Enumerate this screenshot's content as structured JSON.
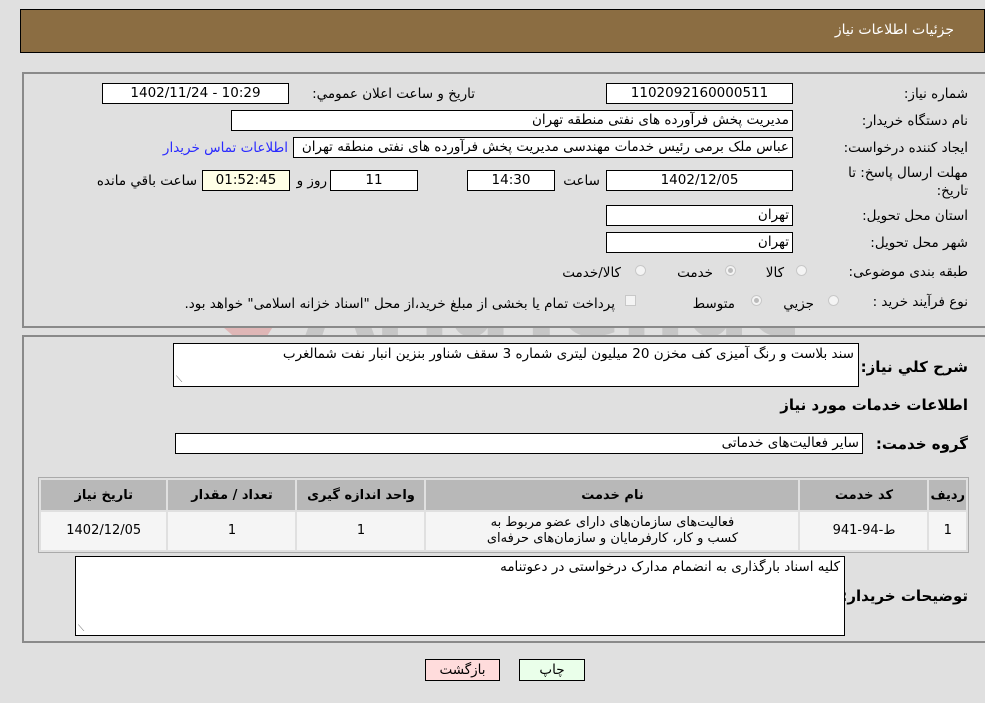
{
  "header": {
    "title": "جزئیات اطلاعات نیاز"
  },
  "form": {
    "need_number_label": "شماره نیاز:",
    "need_number": "1102092160000511",
    "announce_label": "تاریخ و ساعت اعلان عمومي:",
    "announce_value": "1402/11/24 - 10:29",
    "buyer_org_label": "نام دستگاه خریدار:",
    "buyer_org": "مدیریت پخش فرآورده های نفتی منطقه تهران",
    "creator_label": "ایجاد کننده درخواست:",
    "creator": "عباس ملک برمی رئیس خدمات مهندسی مدیریت پخش فرآورده های نفتی منطقه تهران",
    "contact_link": "اطلاعات تماس خریدار",
    "deadline_label": "مهلت ارسال پاسخ: تا تاریخ:",
    "deadline_date": "1402/12/05",
    "time_label": "ساعت",
    "deadline_time": "14:30",
    "days_remaining": "11",
    "days_label": "روز و",
    "time_remaining": "01:52:45",
    "remaining_label": "ساعت باقي مانده",
    "province_label": "استان محل تحویل:",
    "province": "تهران",
    "city_label": "شهر محل تحویل:",
    "city": "تهران",
    "category_label": "طبقه بندی موضوعی:",
    "category_options": [
      "کالا",
      "خدمت",
      "کالا/خدمت"
    ],
    "category_selected": "خدمت",
    "process_label": "نوع فرآیند خرید :",
    "process_options": [
      "جزیي",
      "متوسط"
    ],
    "process_selected": "متوسط",
    "treasury_note": "پرداخت تمام یا بخشی از مبلغ خرید،از محل \"اسناد خزانه اسلامی\" خواهد بود."
  },
  "details": {
    "description_label": "شرح کلي نیاز:",
    "description": "سند بلاست و رنگ آمیزی کف مخزن 20 میلیون لیتری شماره 3 سقف شناور بنزین انبار نفت شمالغرب",
    "services_heading": "اطلاعات خدمات مورد نیاز",
    "service_group_label": "گروه خدمت:",
    "service_group": "سایر فعالیت‌های خدماتی",
    "table": {
      "headers": [
        "ردیف",
        "کد خدمت",
        "نام خدمت",
        "واحد اندازه گیری",
        "تعداد / مقدار",
        "تاریخ نیاز"
      ],
      "rows": [
        [
          "1",
          "ط-94-941",
          "فعالیت‌های سازمان‌های دارای عضو مربوط به کسب و کار، کارفرمایان و سازمان‌های حرفه‌ای",
          "1",
          "1",
          "1402/12/05"
        ]
      ]
    },
    "buyer_notes_label": "توضیحات خریدار:",
    "buyer_notes": "کلیه اسناد بارگذاری به انضمام مدارک درخواستی در دعوتنامه"
  },
  "buttons": {
    "print": "چاپ",
    "back": "بازگشت"
  },
  "watermark": "AriaTender.neT"
}
